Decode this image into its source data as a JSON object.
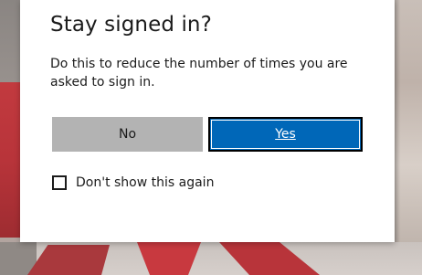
{
  "dialog": {
    "title": "Stay signed in?",
    "description": "Do this to reduce the number of times you are asked to sign in.",
    "no_label": "No",
    "yes_label": "Yes",
    "checkbox_label": "Don't show this again",
    "checkbox_checked": false
  },
  "colors": {
    "primary_button": "#0067b8",
    "secondary_button": "#b3b3b3",
    "dialog_background": "#ffffff",
    "text": "#1b1b1b"
  }
}
